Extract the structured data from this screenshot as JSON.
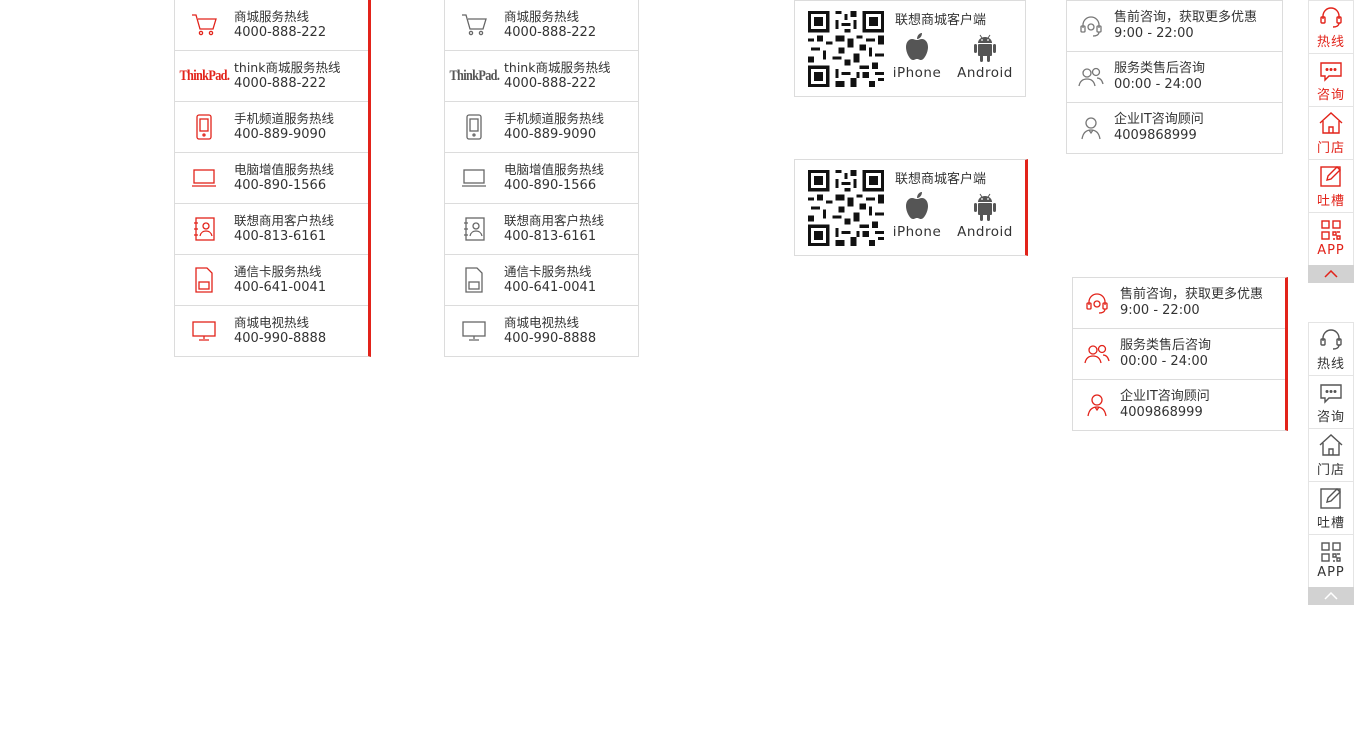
{
  "hotlines": [
    {
      "icon": "cart-icon",
      "label": "商城服务热线",
      "phone": "4000-888-222"
    },
    {
      "icon": "thinkpad-logo",
      "logo_text": "ThinkPad.",
      "label": "think商城服务热线",
      "phone": "4000-888-222"
    },
    {
      "icon": "phone-icon",
      "label": "手机频道服务热线",
      "phone": "400-889-9090"
    },
    {
      "icon": "laptop-icon",
      "label": "电脑增值服务热线",
      "phone": "400-890-1566"
    },
    {
      "icon": "business-contact-icon",
      "label": "联想商用客户热线",
      "phone": "400-813-6161"
    },
    {
      "icon": "sim-card-icon",
      "label": "通信卡服务热线",
      "phone": "400-641-0041"
    },
    {
      "icon": "tv-icon",
      "label": "商城电视热线",
      "phone": "400-990-8888"
    }
  ],
  "app_download": {
    "title": "联想商城客户端",
    "iphone_label": "iPhone",
    "android_label": "Android"
  },
  "consult": [
    {
      "icon": "headset-icon",
      "label": "售前咨询，获取更多优惠",
      "detail": "9:00 - 22:00"
    },
    {
      "icon": "users-icon",
      "label": "服务类售后咨询",
      "detail": "00:00 - 24:00"
    },
    {
      "icon": "user-icon",
      "label": "企业IT咨询顾问",
      "detail": "4009868999"
    }
  ],
  "sidebar": [
    {
      "icon": "headset-icon",
      "label": "热线"
    },
    {
      "icon": "chat-icon",
      "label": "咨询"
    },
    {
      "icon": "home-icon",
      "label": "门店"
    },
    {
      "icon": "edit-icon",
      "label": "吐槽"
    },
    {
      "icon": "qr-icon",
      "label": "APP"
    }
  ],
  "colors": {
    "accent": "#e2231a",
    "border": "#dcdcdc",
    "text": "#333333",
    "icon_gray": "#666666"
  }
}
